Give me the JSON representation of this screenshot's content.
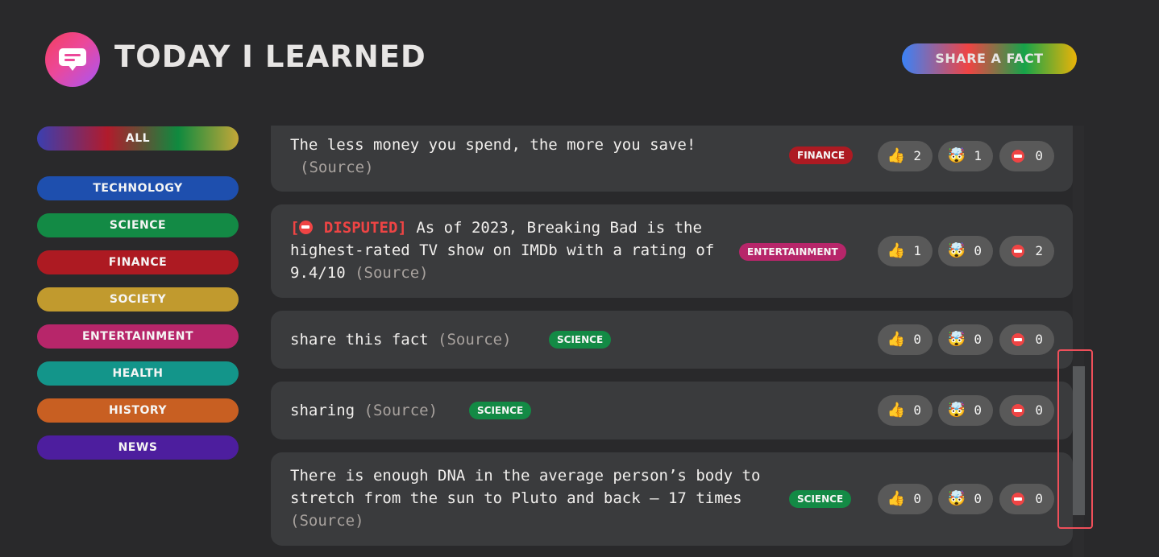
{
  "header": {
    "logo_icon": "chat-bubble-icon",
    "title": "Today I Learned",
    "share_button_label": "Share a fact"
  },
  "categories": [
    {
      "label": "All",
      "color": "gradient"
    },
    {
      "label": "technology",
      "color": "#1e4fae"
    },
    {
      "label": "science",
      "color": "#138a45"
    },
    {
      "label": "finance",
      "color": "#ad1a22"
    },
    {
      "label": "society",
      "color": "#c19a2e"
    },
    {
      "label": "entertainment",
      "color": "#b7266a"
    },
    {
      "label": "health",
      "color": "#13958a"
    },
    {
      "label": "history",
      "color": "#c85f22"
    },
    {
      "label": "news",
      "color": "#4d1e9e"
    }
  ],
  "facts": [
    {
      "text": "The less money you spend, the more you save!",
      "source_label": "(Source)",
      "category": "finance",
      "category_color": "#ad1a22",
      "votes": {
        "interesting": "2",
        "mindblowing": "1",
        "false": "0"
      }
    },
    {
      "disputed_label": "DISPUTED]",
      "disputed_prefix": "[",
      "text": "As of 2023, Breaking Bad is the highest-rated TV show on IMDb with a rating of 9.4/10",
      "source_label": "(Source)",
      "category": "entertainment",
      "category_color": "#b7266a",
      "votes": {
        "interesting": "1",
        "mindblowing": "0",
        "false": "2"
      }
    },
    {
      "text": "share this fact",
      "source_label": "(Source)",
      "category": "science",
      "category_color": "#138a45",
      "votes": {
        "interesting": "0",
        "mindblowing": "0",
        "false": "0"
      }
    },
    {
      "text": "sharing",
      "source_label": "(Source)",
      "category": "science",
      "category_color": "#138a45",
      "votes": {
        "interesting": "0",
        "mindblowing": "0",
        "false": "0"
      }
    },
    {
      "text": "There is enough DNA in the average person’s body to stretch from the sun to Pluto and back — 17 times",
      "source_label": "(Source)",
      "category": "science",
      "category_color": "#138a45",
      "votes": {
        "interesting": "0",
        "mindblowing": "0",
        "false": "0"
      }
    }
  ],
  "vote_icons": {
    "interesting": "👍",
    "mindblowing": "🤯",
    "false_icon": "no-entry-icon"
  },
  "colors": {
    "background": "#29292b",
    "card": "#3a3b3d",
    "vote_button": "#595959",
    "disputed": "#ef4444",
    "highlight": "#ef4f5a"
  }
}
